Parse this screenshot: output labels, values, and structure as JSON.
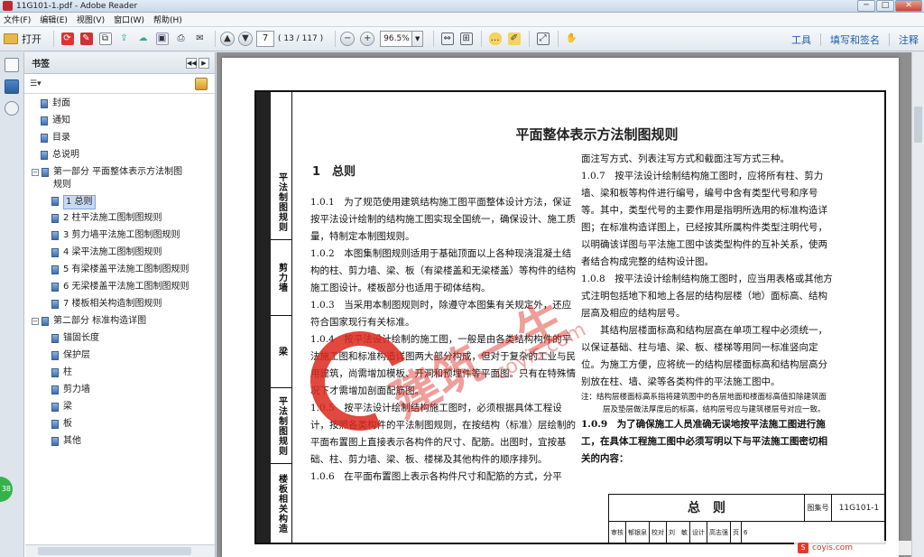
{
  "window": {
    "title": "11G101-1.pdf - Adobe Reader",
    "minimize": "─",
    "maximize": "□",
    "close": "✕"
  },
  "menu": [
    "文件(F)",
    "编辑(E)",
    "视图(V)",
    "窗口(W)",
    "帮助(H)"
  ],
  "toolbar": {
    "open": "打开",
    "page_current": "7",
    "page_count": "( 13 / 117 )",
    "zoom": "96.5%",
    "right": [
      "工具",
      "填写和签名",
      "注释"
    ]
  },
  "bookmarks": {
    "title": "书签",
    "options": "☰▾",
    "items": [
      {
        "label": "封面",
        "level": 1
      },
      {
        "label": "通知",
        "level": 1
      },
      {
        "label": "目录",
        "level": 1
      },
      {
        "label": "总说明",
        "level": 1
      },
      {
        "label": "第一部分 平面整体表示方法制图规则",
        "level": 0,
        "expanded": true
      },
      {
        "label": "1 总则",
        "level": 2,
        "selected": true
      },
      {
        "label": "2 柱平法施工图制图规则",
        "level": 2
      },
      {
        "label": "3 剪力墙平法施工图制图规则",
        "level": 2
      },
      {
        "label": "4 梁平法施工图制图规则",
        "level": 2
      },
      {
        "label": "5 有梁楼盖平法施工图制图规则",
        "level": 2
      },
      {
        "label": "6 无梁楼盖平法施工图制图规则",
        "level": 2
      },
      {
        "label": "7 楼板相关构造制图规则",
        "level": 2
      },
      {
        "label": "第二部分 标准构造详图",
        "level": 0,
        "expanded": true
      },
      {
        "label": "锚固长度",
        "level": 1
      },
      {
        "label": "保护层",
        "level": 1
      },
      {
        "label": "柱",
        "level": 1
      },
      {
        "label": "剪力墙",
        "level": 1
      },
      {
        "label": "梁",
        "level": 1
      },
      {
        "label": "板",
        "level": 1
      },
      {
        "label": "其他",
        "level": 1
      }
    ]
  },
  "page": {
    "title": "平面整体表示方法制图规则",
    "section": "1　总则",
    "side_tabs": [
      "平法制图规则",
      "剪力墙",
      "梁",
      "平法制图规则",
      "楼板相关构造"
    ],
    "left_paragraphs": [
      "1.0.1　为了规范使用建筑结构施工图平面整体设计方法，保证按平法设计绘制的结构施工图实现全国统一，确保设计、施工质量，特制定本制图规则。",
      "1.0.2　本图集制图规则适用于基础顶面以上各种现浇混凝土结构的柱、剪力墙、梁、板（有梁楼盖和无梁楼盖）等构件的结构施工图设计。楼板部分也适用于砌体结构。",
      "1.0.3　当采用本制图规则时，除遵守本图集有关规定外，还应符合国家现行有关标准。",
      "1.0.4　按平法设计绘制的施工图，一般是由各类结构构件的平法施工图和标准构造详图两大部分构成，但对于复杂的工业与民用建筑，尚需增加模板、开洞和预埋件等平面图。只有在特殊情况下才需增加剖面配筋图。",
      "1.0.5　按平法设计绘制结构施工图时，必须根据具体工程设计，按照各类构件的平法制图规则，在按结构（标准）层绘制的平面布置图上直接表示各构件的尺寸、配筋。出图时，宜按基础、柱、剪力墙、梁、板、楼梯及其他构件的顺序排列。",
      "1.0.6　在平面布置图上表示各构件尺寸和配筋的方式，分平"
    ],
    "right_paragraphs": [
      "面注写方式、列表注写方式和截面注写方式三种。",
      "1.0.7　按平法设计绘制结构施工图时，应将所有柱、剪力墙、梁和板等构件进行编号，编号中含有类型代号和序号等。其中，类型代号的主要作用是指明所选用的标准构造详图；在标准构造详图上，已经按其所属构件类型注明代号，以明确该详图与平法施工图中该类型构件的互补关系，使两者结合构成完整的结构设计图。",
      "1.0.8　按平法设计绘制结构施工图时，应当用表格或其他方式注明包括地下和地上各层的结构层楼（地）面标高、结构层高及相应的结构层号。",
      "其结构层楼面标高和结构层高在单项工程中必须统一，以保证基础、柱与墙、梁、板、楼梯等用同一标准竖向定位。为施工方便，应将统一的结构层楼面标高和结构层高分别放在柱、墙、梁等各类构件的平法施工图中。"
    ],
    "note": "注：结构层楼面标高系指将建筑图中的各层地面和楼面标高值扣除建筑面层及垫层做法厚度后的标高，结构层号应与建筑楼层号对应一致。",
    "last_paragraph": "1.0.9　为了确保施工人员准确无误地按平法施工图进行施工，在具体工程施工图中必须写明以下与平法施工图密切相关的内容：",
    "titleblock": {
      "name": "总　则",
      "label": "图集号",
      "number": "11G101-1",
      "row2": [
        "审核",
        "郁银泉",
        "校对",
        "刘　敏",
        "设计",
        "高志强",
        "页",
        "6"
      ]
    }
  },
  "watermark": {
    "text": "建筑一生",
    "small": "coyis.com"
  },
  "side_button": "38",
  "bottom": {
    "s": "S",
    "site": "coyis.com"
  }
}
